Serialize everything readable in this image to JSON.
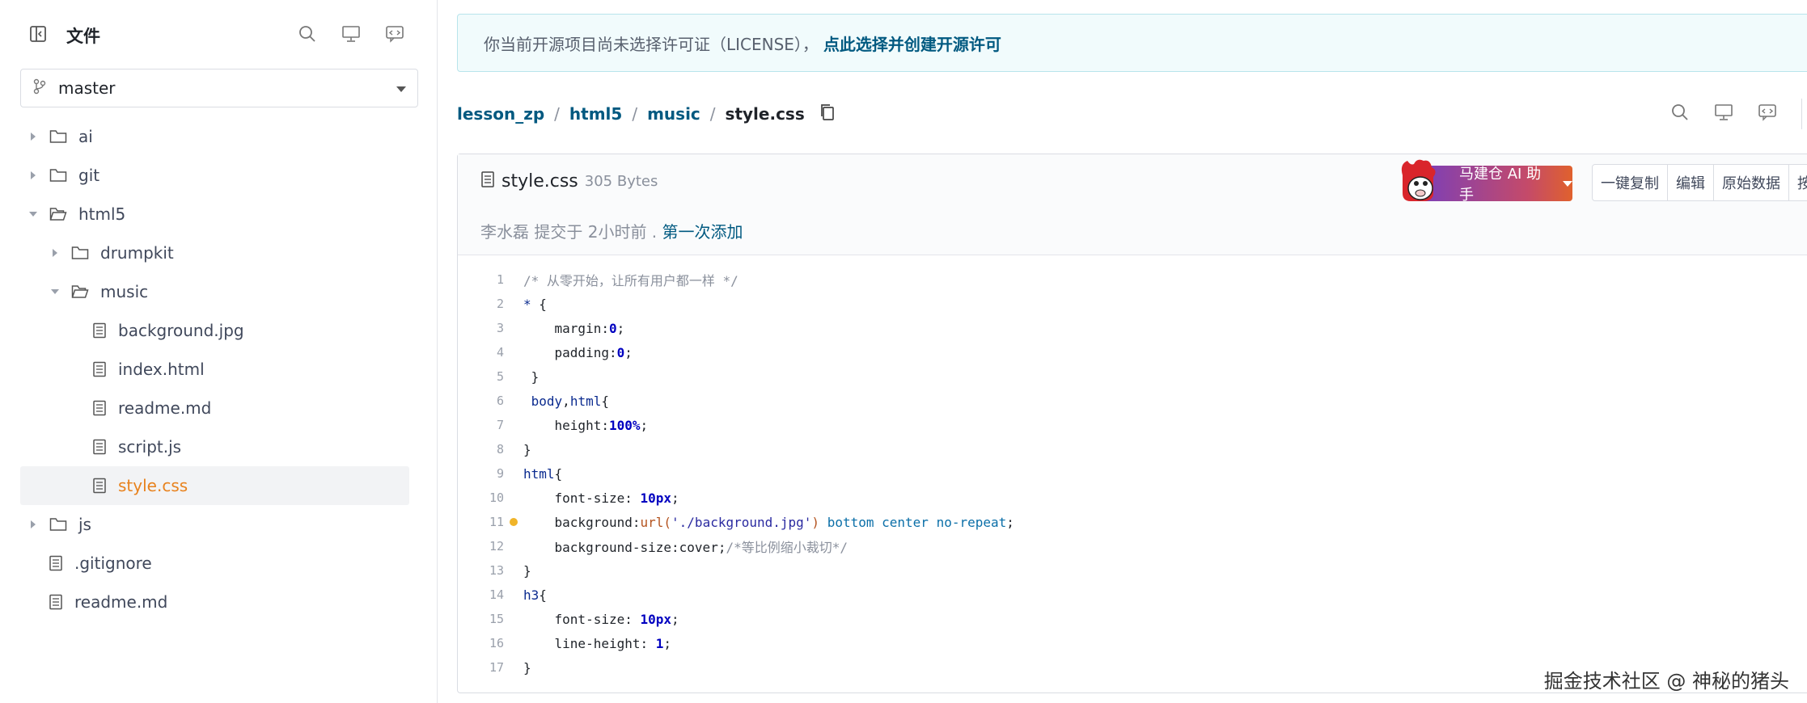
{
  "sidebar": {
    "title": "文件",
    "branch": "master",
    "tree": [
      {
        "label": "ai",
        "type": "folder",
        "level": 0,
        "state": "collapsed"
      },
      {
        "label": "git",
        "type": "folder",
        "level": 0,
        "state": "collapsed"
      },
      {
        "label": "html5",
        "type": "folder",
        "level": 0,
        "state": "expanded"
      },
      {
        "label": "drumpkit",
        "type": "folder",
        "level": 1,
        "state": "collapsed"
      },
      {
        "label": "music",
        "type": "folder",
        "level": 1,
        "state": "expanded"
      },
      {
        "label": "background.jpg",
        "type": "file",
        "level": 2
      },
      {
        "label": "index.html",
        "type": "file",
        "level": 2
      },
      {
        "label": "readme.md",
        "type": "file",
        "level": 2
      },
      {
        "label": "script.js",
        "type": "file",
        "level": 2
      },
      {
        "label": "style.css",
        "type": "file",
        "level": 2,
        "active": true
      },
      {
        "label": "js",
        "type": "folder",
        "level": 0,
        "state": "collapsed"
      },
      {
        "label": ".gitignore",
        "type": "file",
        "level": 0
      },
      {
        "label": "readme.md",
        "type": "file",
        "level": 0
      }
    ]
  },
  "notice": {
    "text": "你当前开源项目尚未选择许可证（LICENSE），",
    "link": "点此选择并创建开源许可"
  },
  "breadcrumb": {
    "items": [
      "lesson_zp",
      "html5",
      "music"
    ],
    "current": "style.css"
  },
  "file": {
    "name": "style.css",
    "size": "305 Bytes",
    "commit_text": "李水磊 提交于 2小时前 .",
    "commit_msg": "第一次添加",
    "ai_button": "马建仓 AI 助手",
    "actions": [
      "一键复制",
      "编辑",
      "原始数据",
      "按"
    ]
  },
  "code_lines": [
    "1",
    "2",
    "3",
    "4",
    "5",
    "6",
    "7",
    "8",
    "9",
    "10",
    "11",
    "12",
    "13",
    "14",
    "15",
    "16",
    "17"
  ],
  "code": {
    "l1": "/* 从零开始，让所有用户都一样 */",
    "l11_url": "'./background.jpg'",
    "l12_comment": "/*等比例缩小裁切*/"
  },
  "watermark": "掘金技术社区 @ 神秘的猪头",
  "colors": {
    "accent": "#005980",
    "active_file": "#e8821d",
    "marker": "#f0b429"
  }
}
